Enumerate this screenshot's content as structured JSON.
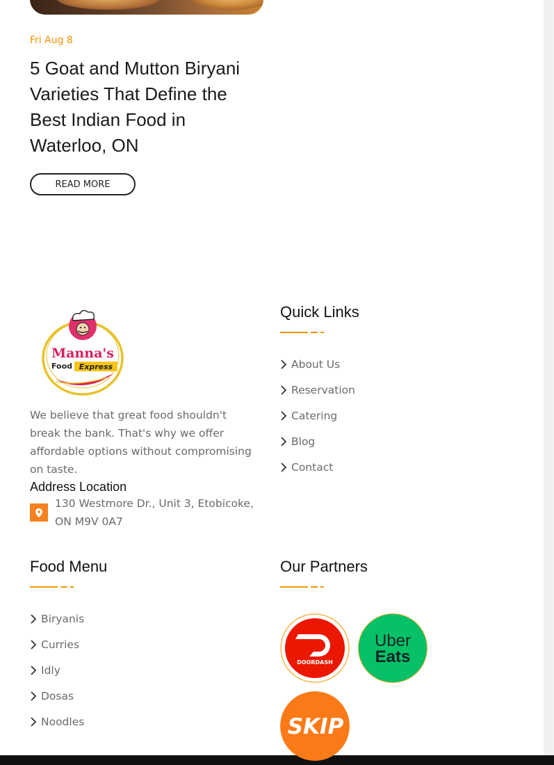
{
  "post": {
    "date": "Fri Aug 8",
    "title": "5 Goat and Mutton Biryani Varieties That Define the Best Indian Food in Waterloo, ON",
    "read_more_label": "READ MORE"
  },
  "footer": {
    "logo": {
      "line1": "Manna's",
      "line2": "Food",
      "line3": "Express"
    },
    "about_text": "We believe that great food shouldn't break the bank. That's why we offer affordable options without compromising on taste.",
    "address_heading": "Address Location",
    "address": "130 Westmore Dr., Unit 3, Etobicoke, ON M9V 0A7",
    "quick_links": {
      "heading": "Quick Links",
      "items": [
        "About Us",
        "Reservation",
        "Catering",
        "Blog",
        "Contact"
      ]
    },
    "food_menu": {
      "heading": "Food Menu",
      "items": [
        "Biryanis",
        "Curries",
        "Idly",
        "Dosas",
        "Noodles"
      ]
    },
    "partners": {
      "heading": "Our Partners",
      "doordash_label": "DOORDASH",
      "ubereats_line1": "Uber",
      "ubereats_line2": "Eats",
      "skip_label": "SKIP"
    }
  },
  "colors": {
    "accent": "#f39200",
    "doordash": "#eb1700",
    "ubereats": "#06c167",
    "skip": "#fa7a18"
  }
}
